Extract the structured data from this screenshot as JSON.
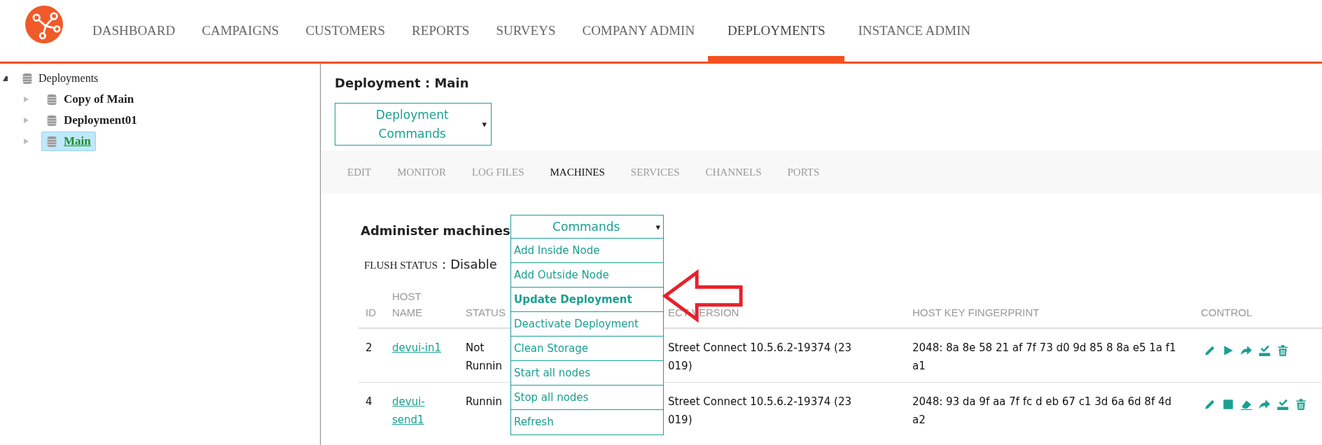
{
  "nav": [
    {
      "label": "DASHBOARD",
      "selected": false
    },
    {
      "label": "CAMPAIGNS",
      "selected": false
    },
    {
      "label": "CUSTOMERS",
      "selected": false
    },
    {
      "label": "REPORTS",
      "selected": false
    },
    {
      "label": "SURVEYS",
      "selected": false
    },
    {
      "label": "COMPANY ADMIN",
      "selected": false
    },
    {
      "label": "DEPLOYMENTS",
      "selected": true
    },
    {
      "label": "INSTANCE ADMIN",
      "selected": false
    }
  ],
  "tree": {
    "label": "Deployments",
    "expanded": true,
    "children": [
      {
        "label": "Copy of Main",
        "expanded": false,
        "selected": false
      },
      {
        "label": "Deployment01",
        "expanded": false,
        "selected": false
      },
      {
        "label": "Main",
        "expanded": false,
        "selected": true
      }
    ]
  },
  "title": "Deployment : Main",
  "deployment_commands": {
    "label": "Deployment Commands",
    "caret": "▾"
  },
  "tabs": [
    {
      "label": "EDIT",
      "selected": false
    },
    {
      "label": "MONITOR",
      "selected": false
    },
    {
      "label": "LOG FILES",
      "selected": false
    },
    {
      "label": "MACHINES",
      "selected": true
    },
    {
      "label": "SERVICES",
      "selected": false
    },
    {
      "label": "CHANNELS",
      "selected": false
    },
    {
      "label": "PORTS",
      "selected": false
    }
  ],
  "section_title": "Administer machines",
  "commands": {
    "label": "Commands",
    "caret": "▾",
    "items": [
      {
        "label": "Add Inside Node",
        "highlighted": false
      },
      {
        "label": "Add Outside Node",
        "highlighted": false
      },
      {
        "label": "Update Deployment",
        "highlighted": true
      },
      {
        "label": "Deactivate Deployment",
        "highlighted": false
      },
      {
        "label": "Clean Storage",
        "highlighted": false
      },
      {
        "label": "Start all nodes",
        "highlighted": false
      },
      {
        "label": "Stop all nodes",
        "highlighted": false
      },
      {
        "label": "Refresh",
        "highlighted": false
      }
    ]
  },
  "flush_status": {
    "label": "FLUSH STATUS",
    "separator": ":",
    "value": "Disable"
  },
  "table": {
    "columns": [
      "ID",
      "HOST NAME",
      "STATUS",
      "ECT VERSION",
      "HOST KEY FINGERPRINT",
      "CONTROL"
    ],
    "rows": [
      {
        "id": "2",
        "host": "devui-in1",
        "status": "Not Runnin",
        "version": [
          "Street Connect 10.5.6.2-19374 (23",
          "019)"
        ],
        "fingerprint": "2048: 8a 8e 58 21 af 7f 73 d0 9d 85 8 8a e5 1a f1 a1",
        "controls": [
          {
            "kind": "edit"
          },
          {
            "kind": "play"
          },
          {
            "kind": "forward"
          },
          {
            "kind": "deploy"
          },
          {
            "kind": "delete"
          }
        ]
      },
      {
        "id": "4",
        "host": "devui-send1",
        "status": "Runnin",
        "version": [
          "Street Connect 10.5.6.2-19374 (23",
          "019)"
        ],
        "fingerprint": "2048: 93 da 9f aa 7f fc d eb 67 c1 3d 6a 6d 8f 4d a2",
        "controls": [
          {
            "kind": "edit"
          },
          {
            "kind": "stop"
          },
          {
            "kind": "erase"
          },
          {
            "kind": "forward"
          },
          {
            "kind": "deploy"
          },
          {
            "kind": "delete"
          }
        ]
      }
    ]
  }
}
